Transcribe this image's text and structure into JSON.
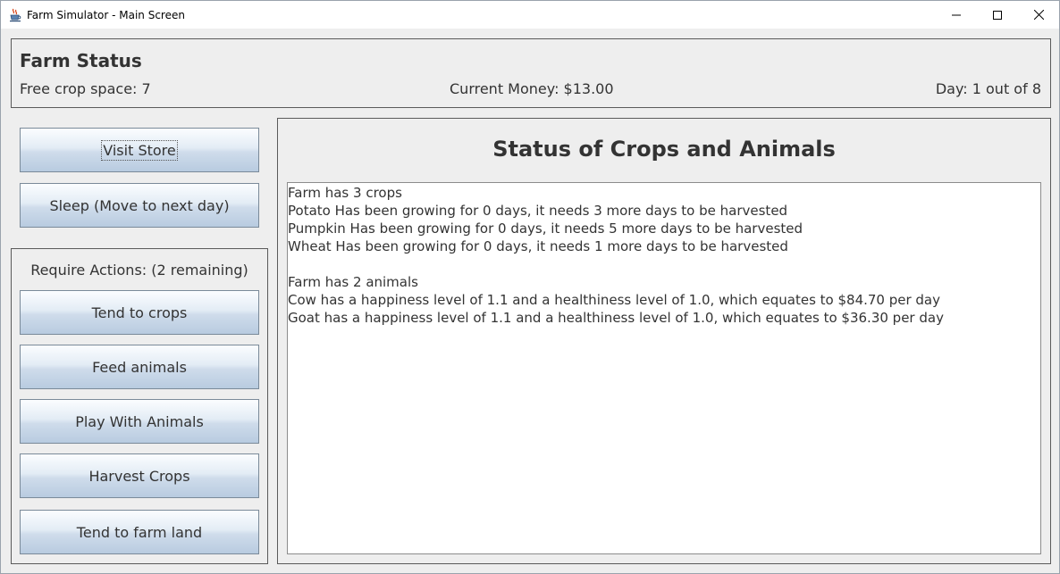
{
  "window": {
    "title": "Farm Simulator - Main Screen"
  },
  "farm_status": {
    "heading": "Farm Status",
    "free_crop_space": "Free crop space: 7",
    "current_money": "Current Money: $13.00",
    "day": "Day: 1 out of 8"
  },
  "buttons": {
    "visit_store": "Visit Store",
    "sleep": "Sleep (Move to next day)"
  },
  "actions": {
    "label": "Require Actions: (2 remaining)",
    "items": [
      "Tend to crops",
      "Feed animals",
      "Play With Animals",
      "Harvest Crops",
      "Tend to farm land"
    ]
  },
  "status_panel": {
    "heading": "Status of Crops and Animals",
    "lines": [
      "Farm has 3 crops",
      "Potato Has been growing for 0 days, it needs 3 more days to be harvested",
      "Pumpkin Has been growing for 0 days, it needs 5 more days to be harvested",
      "Wheat Has been growing for 0 days, it needs 1 more days to be harvested",
      "",
      "Farm has 2 animals",
      "Cow has a happiness level of 1.1 and a healthiness level of 1.0, which equates to $84.70 per day",
      "Goat has a happiness level of 1.1 and a healthiness level of 1.0, which equates to $36.30 per day"
    ]
  },
  "icons": {
    "app": "java-coffee-cup-icon",
    "minimize": "minimize-icon",
    "maximize": "maximize-icon",
    "close": "close-icon"
  }
}
